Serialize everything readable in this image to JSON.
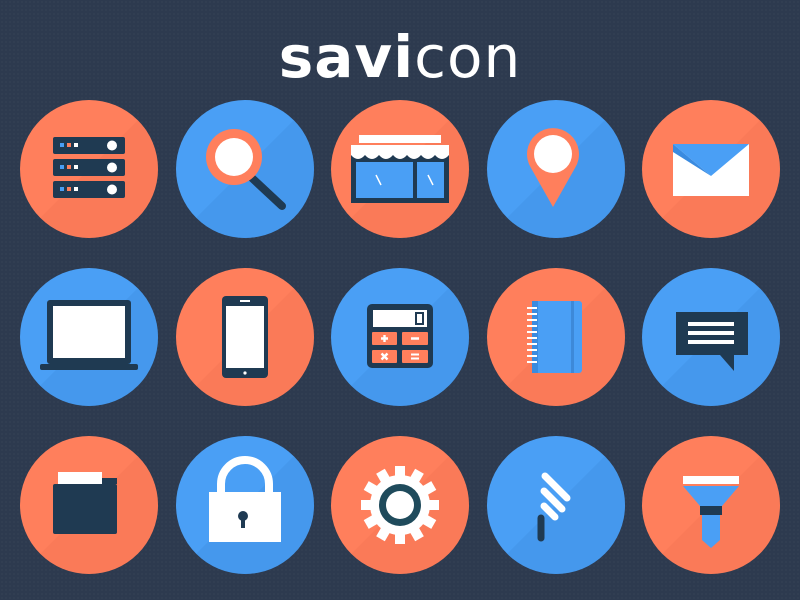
{
  "logo": {
    "part_bold": "savi",
    "part_light": "con"
  },
  "colors": {
    "background": "#2d3a4f",
    "orange": "#ff7f5c",
    "blue": "#4a9ff5",
    "navy": "#1f3a52",
    "white": "#ffffff"
  },
  "icons": [
    {
      "name": "server-icon",
      "bg": "orange"
    },
    {
      "name": "search-icon",
      "bg": "blue"
    },
    {
      "name": "shop-icon",
      "bg": "orange"
    },
    {
      "name": "location-pin-icon",
      "bg": "blue"
    },
    {
      "name": "mail-icon",
      "bg": "orange"
    },
    {
      "name": "laptop-icon",
      "bg": "blue"
    },
    {
      "name": "smartphone-icon",
      "bg": "orange"
    },
    {
      "name": "calculator-icon",
      "bg": "blue"
    },
    {
      "name": "notebook-icon",
      "bg": "orange"
    },
    {
      "name": "chat-bubble-icon",
      "bg": "blue"
    },
    {
      "name": "folder-icon",
      "bg": "orange"
    },
    {
      "name": "lock-icon",
      "bg": "blue"
    },
    {
      "name": "gear-icon",
      "bg": "orange"
    },
    {
      "name": "wifi-signal-icon",
      "bg": "blue"
    },
    {
      "name": "funnel-icon",
      "bg": "orange"
    }
  ]
}
